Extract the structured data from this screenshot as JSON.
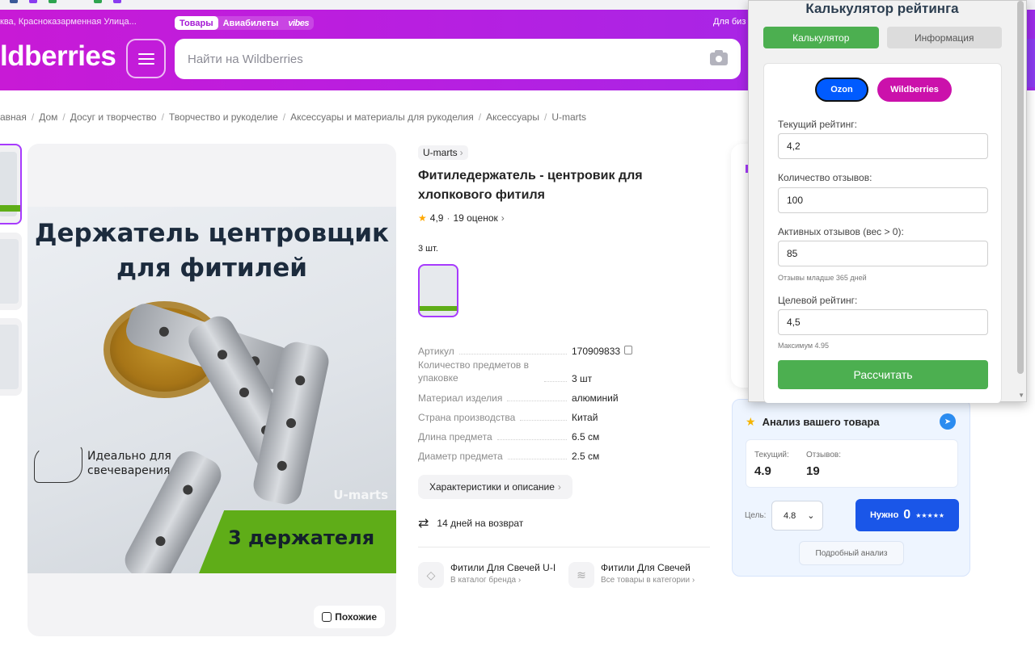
{
  "header": {
    "location": "ква, Красноказарменная Улица...",
    "tabs": [
      "Товары",
      "Авиабилеты",
      "vibes"
    ],
    "for_business": "Для биз",
    "logo": "ldberries",
    "search_placeholder": "Найти на Wildberries"
  },
  "breadcrumb": [
    "авная",
    "Дом",
    "Досуг и творчество",
    "Творчество и рукоделие",
    "Аксессуары и материалы для рукоделия",
    "Аксессуары",
    "U-marts"
  ],
  "product_image": {
    "title_line1": "Держатель центровщик",
    "title_line2": "для фитилей",
    "hand_text_line1": "Идеально для",
    "hand_text_line2": "свечеварения",
    "watermark": "U-marts",
    "banner": "3 держателя",
    "similar_label": "Похожие"
  },
  "product": {
    "brand": "U-marts",
    "title": "Фитиледержатель - центровик для хлопкового фитиля",
    "rating": "4,9",
    "reviews": "19 оценок",
    "qty_label": "3 шт.",
    "specs": [
      {
        "k": "Артикул",
        "v": "170909833"
      },
      {
        "k": "Количество предметов в упаковке",
        "v": "3 шт"
      },
      {
        "k": "Материал изделия",
        "v": "алюминий"
      },
      {
        "k": "Страна производства",
        "v": "Китай"
      },
      {
        "k": "Длина предмета",
        "v": "6.5 см"
      },
      {
        "k": "Диаметр предмета",
        "v": "2.5 см"
      }
    ],
    "char_button": "Характеристики и описание",
    "return_text": "14 дней на возврат",
    "brand_link_title": "Фитили Для Свечей U-I",
    "brand_link_sub": "В каталог бренда",
    "cat_link_title": "Фитили Для Свечей",
    "cat_link_sub": "Все товары в категории"
  },
  "analysis": {
    "title": "Анализ вашего товара",
    "current_label": "Текущий:",
    "current_value": "4.9",
    "reviews_label": "Отзывов:",
    "reviews_value": "19",
    "goal_label": "Цель:",
    "goal_value": "4.8",
    "need_label": "Нужно",
    "need_value": "0",
    "need_stars": "★★★★★",
    "detail_button": "Подробный анализ"
  },
  "popup": {
    "title": "Калькулятор рейтинга",
    "tab_calc": "Калькулятор",
    "tab_info": "Информация",
    "marketplaces": [
      "Ozon",
      "Wildberries"
    ],
    "current_rating_label": "Текущий рейтинг:",
    "current_rating_value": "4,2",
    "reviews_count_label": "Количество отзывов:",
    "reviews_count_value": "100",
    "active_reviews_label": "Активных отзывов (вес > 0):",
    "active_reviews_value": "85",
    "active_reviews_hint": "Отзывы младше 365 дней",
    "target_rating_label": "Целевой рейтинг:",
    "target_rating_value": "4,5",
    "target_rating_hint": "Максимум 4.95",
    "calculate_button": "Рассчитать"
  },
  "colors": {
    "header_gradient_start": "#c81ad6",
    "header_gradient_end": "#9c2bea",
    "accent_purple": "#a73afd",
    "green": "#4caf50",
    "ozon_blue": "#005bff",
    "wb_magenta": "#cb11ab",
    "need_blue": "#1a56e8"
  }
}
